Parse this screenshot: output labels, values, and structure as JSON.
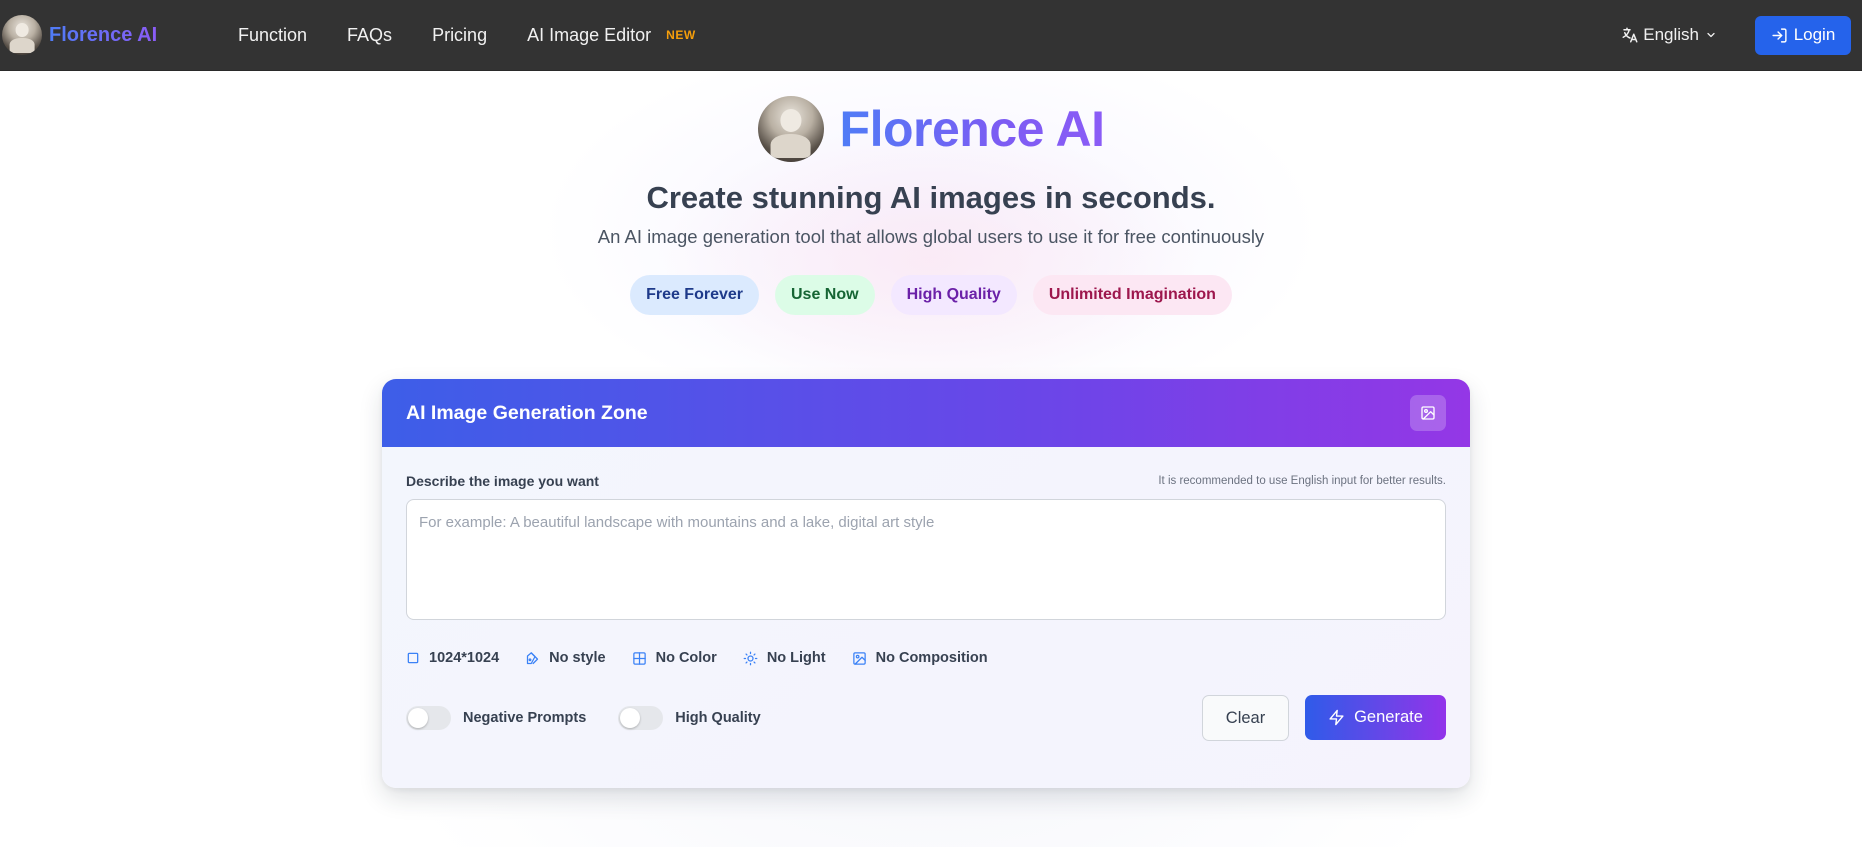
{
  "navbar": {
    "brand_name": "Florence AI",
    "links": [
      "Function",
      "FAQs",
      "Pricing",
      "AI Image Editor"
    ],
    "editor_badge": "NEW",
    "language": "English",
    "login_label": "Login"
  },
  "hero": {
    "title": "Florence AI",
    "headline": "Create stunning AI images in seconds.",
    "subtitle": "An AI image generation tool that allows global users to use it for free continuously",
    "pills": [
      "Free Forever",
      "Use Now",
      "High Quality",
      "Unlimited Imagination"
    ]
  },
  "generator": {
    "title": "AI Image Generation Zone",
    "prompt_label": "Describe the image you want",
    "prompt_hint": "It is recommended to use English input for better results.",
    "prompt_value": "",
    "prompt_placeholder": "For example: A beautiful landscape with mountains and a lake, digital art style",
    "options": {
      "size": "1024*1024",
      "style": "No style",
      "color": "No Color",
      "light": "No Light",
      "composition": "No Composition"
    },
    "toggles": {
      "negative_prompts": {
        "label": "Negative Prompts",
        "on": false
      },
      "high_quality": {
        "label": "High Quality",
        "on": false
      }
    },
    "clear_label": "Clear",
    "generate_label": "Generate"
  },
  "colors": {
    "navbar_bg": "#333333",
    "primary_blue": "#2563eb",
    "accent_purple": "#8b5cf6",
    "badge_orange": "#f59e0b"
  }
}
